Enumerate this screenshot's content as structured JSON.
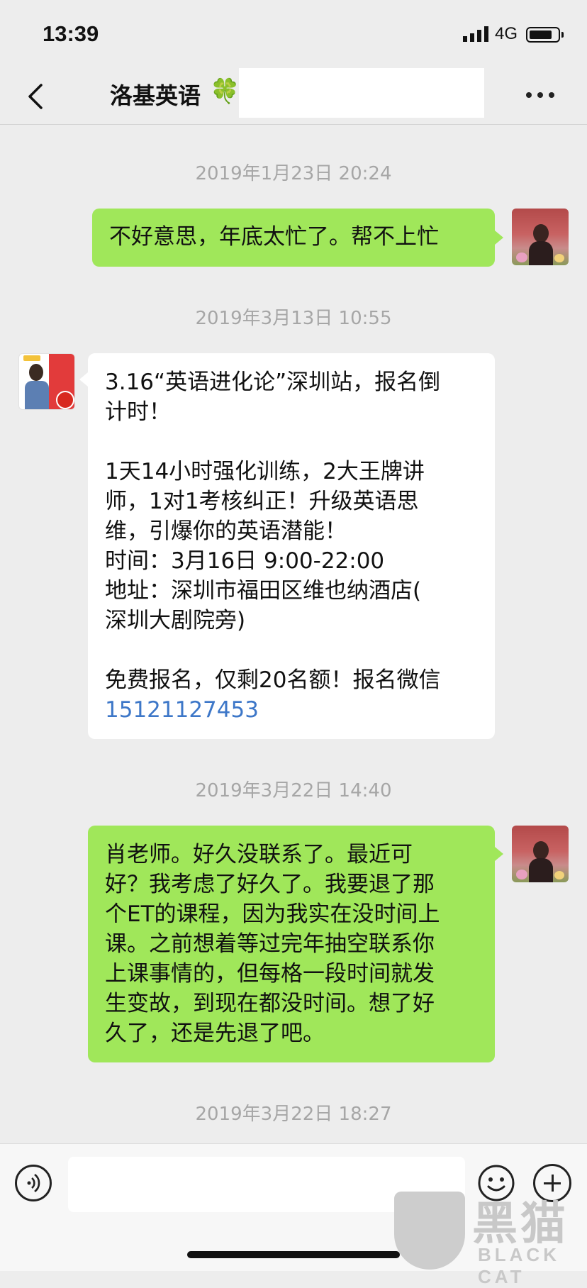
{
  "status_bar": {
    "time": "13:39",
    "network": "4G",
    "battery_level": 0.7
  },
  "nav": {
    "title": "洛基英语",
    "title_emoji": "🍀",
    "back_icon": "chevron-left-icon",
    "more_icon": "ellipsis-icon"
  },
  "messages": [
    {
      "timestamp": "2019年1月23日 20:24"
    },
    {
      "sender": "me",
      "text": "不好意思，年底太忙了。帮不上忙"
    },
    {
      "timestamp": "2019年3月13日 10:55"
    },
    {
      "sender": "them",
      "text_before_link": "3.16“英语进化论”深圳站，报名倒\n计时！\n\n1天14小时强化训练，2大王牌讲\n师，1对1考核纠正！升级英语思\n维，引爆你的英语潜能！\n时间：3月16日 9:00-22:00\n地址：深圳市福田区维也纳酒店(\n深圳大剧院旁)\n\n免费报名，仅剩20名额！报名微信\n",
      "link": "15121127453"
    },
    {
      "timestamp": "2019年3月22日 14:40"
    },
    {
      "sender": "me",
      "text": "肖老师。好久没联系了。最近可\n好？我考虑了好久了。我要退了那\n个ET的课程，因为我实在没时间上\n课。之前想着等过完年抽空联系你\n上课事情的，但每格一段时间就发\n生变故，到现在都没时间。想了好\n久了，还是先退了吧。"
    },
    {
      "timestamp": "2019年3月22日 18:27"
    }
  ],
  "input_bar": {
    "voice_icon": "voice-icon",
    "emoji_icon": "emoji-icon",
    "plus_icon": "plus-icon",
    "value": ""
  },
  "watermark": {
    "cn": "黑猫",
    "en": "BLACK CAT"
  },
  "colors": {
    "my_bubble": "#a0e75a",
    "their_bubble": "#ffffff",
    "background": "#ededed",
    "link": "#3d77c8"
  }
}
